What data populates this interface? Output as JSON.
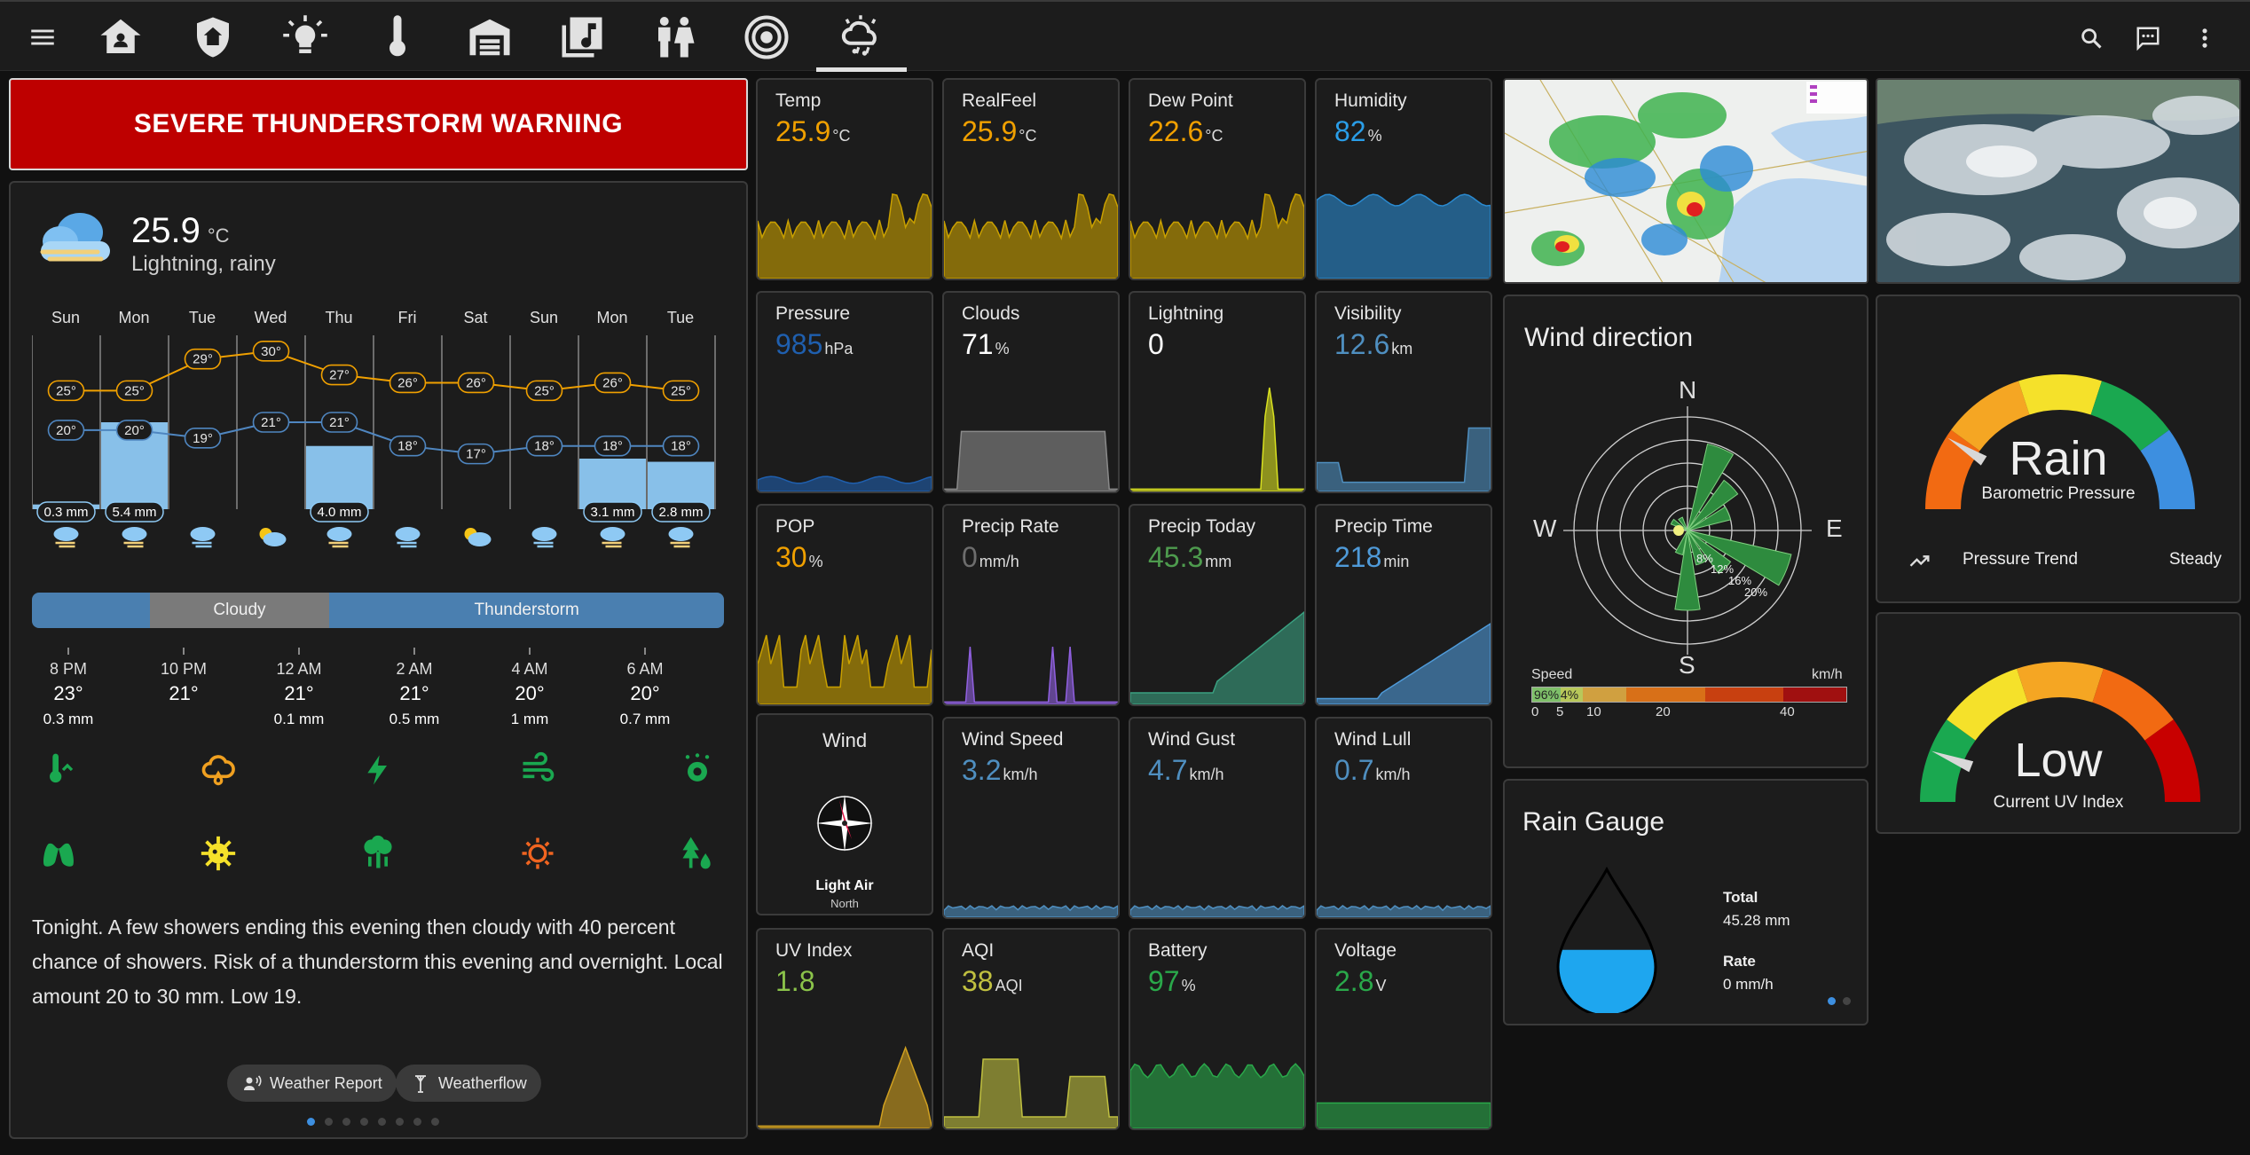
{
  "topbar": {
    "tabs": [
      {
        "name": "menu-icon"
      },
      {
        "name": "home-icon"
      },
      {
        "name": "security-shield-icon"
      },
      {
        "name": "lightbulb-icon"
      },
      {
        "name": "thermometer-icon"
      },
      {
        "name": "garage-icon"
      },
      {
        "name": "music-library-icon"
      },
      {
        "name": "people-icon"
      },
      {
        "name": "speaker-icon"
      },
      {
        "name": "weather-icon"
      }
    ],
    "actions": [
      "search-icon",
      "chat-icon",
      "more-vert-icon"
    ]
  },
  "warning": {
    "text": "SEVERE THUNDERSTORM WARNING",
    "color": "#be0000"
  },
  "forecast": {
    "temp": "25.9",
    "unit": "°C",
    "condition": "Lightning, rainy",
    "days": [
      "Sun",
      "Mon",
      "Tue",
      "Wed",
      "Thu",
      "Fri",
      "Sat",
      "Sun",
      "Mon",
      "Tue"
    ],
    "highs": [
      "25°",
      "25°",
      "29°",
      "30°",
      "27°",
      "26°",
      "26°",
      "25°",
      "26°",
      "25°"
    ],
    "lows": [
      "20°",
      "20°",
      "19°",
      "21°",
      "21°",
      "18°",
      "17°",
      "18°",
      "18°",
      "18°"
    ],
    "precip": [
      {
        "day": 0,
        "amount": "0.3 mm",
        "level": 0.03
      },
      {
        "day": 1,
        "amount": "5.4 mm",
        "level": 0.55
      },
      {
        "day": 4,
        "amount": "4.0 mm",
        "level": 0.4
      },
      {
        "day": 8,
        "amount": "3.1 mm",
        "level": 0.32
      },
      {
        "day": 9,
        "amount": "2.8 mm",
        "level": 0.3
      }
    ],
    "condbar": [
      {
        "label": "",
        "fraction": 0.17,
        "color": "#4a7fb0"
      },
      {
        "label": "Cloudy",
        "fraction": 0.26,
        "color": "#7a7a7a"
      },
      {
        "label": "Thunderstorm",
        "fraction": 0.57,
        "color": "#4a7fb0"
      }
    ],
    "hours": [
      {
        "time": "8 PM",
        "temp": "23°",
        "precip": "0.3 mm"
      },
      {
        "time": "10 PM",
        "temp": "21°",
        "precip": ""
      },
      {
        "time": "12 AM",
        "temp": "21°",
        "precip": "0.1 mm"
      },
      {
        "time": "2 AM",
        "temp": "21°",
        "precip": "0.5 mm"
      },
      {
        "time": "4 AM",
        "temp": "20°",
        "precip": "1 mm"
      },
      {
        "time": "6 AM",
        "temp": "20°",
        "precip": "0.7 mm"
      }
    ],
    "narrative": "Tonight. A few showers ending this evening then cloudy with 40 percent chance of showers. Risk of a thunderstorm this evening and overnight. Local amount 20 to 30 mm. Low 19.",
    "chips": [
      "Weather Report",
      "Weatherflow"
    ]
  },
  "sensors": [
    {
      "name": "Temp",
      "value": "25.9",
      "unit": "°C",
      "color": "#f0a000"
    },
    {
      "name": "RealFeel",
      "value": "25.9",
      "unit": "°C",
      "color": "#f0a000"
    },
    {
      "name": "Dew Point",
      "value": "22.6",
      "unit": "°C",
      "color": "#f0a000"
    },
    {
      "name": "Humidity",
      "value": "82",
      "unit": "%",
      "color": "#2a9ee8"
    },
    {
      "name": "Pressure",
      "value": "985",
      "unit": "hPa",
      "color": "#1f5fae"
    },
    {
      "name": "Clouds",
      "value": "71",
      "unit": "%",
      "color": "#ffffff"
    },
    {
      "name": "Lightning",
      "value": "0",
      "unit": "",
      "color": "#ffffff"
    },
    {
      "name": "Visibility",
      "value": "12.6",
      "unit": "km",
      "color": "#4f8fc0"
    },
    {
      "name": "POP",
      "value": "30",
      "unit": "%",
      "color": "#f0a000"
    },
    {
      "name": "Precip Rate",
      "value": "0",
      "unit": "mm/h",
      "color": "#6d6d6d"
    },
    {
      "name": "Precip Today",
      "value": "45.3",
      "unit": "mm",
      "color": "#4e9b4e"
    },
    {
      "name": "Precip Time",
      "value": "218",
      "unit": "min",
      "color": "#4f9ad8"
    },
    {
      "name": "Wind Speed",
      "value": "3.2",
      "unit": "km/h",
      "color": "#4f8fc0"
    },
    {
      "name": "Wind Gust",
      "value": "4.7",
      "unit": "km/h",
      "color": "#4f8fc0"
    },
    {
      "name": "Wind Lull",
      "value": "0.7",
      "unit": "km/h",
      "color": "#4f8fc0"
    },
    {
      "name": "UV Index",
      "value": "1.8",
      "unit": "",
      "color": "#8bc34a"
    },
    {
      "name": "AQI",
      "value": "38",
      "unit": "AQI",
      "color": "#c0c040"
    },
    {
      "name": "Battery",
      "value": "97",
      "unit": "%",
      "color": "#2aa84a"
    },
    {
      "name": "Voltage",
      "value": "2.8",
      "unit": "V",
      "color": "#2aa84a"
    }
  ],
  "wind_card": {
    "title": "Wind",
    "description": "Light Air",
    "direction": "North"
  },
  "wind_rose": {
    "title": "Wind direction",
    "cardinals": [
      "N",
      "E",
      "S",
      "W"
    ],
    "rings": [
      "8%",
      "12%",
      "16%",
      "20%"
    ],
    "speed_label": "Speed",
    "speed_unit": "km/h",
    "speed_ticks": [
      "0",
      "5",
      "10",
      "20",
      "40"
    ],
    "speed_pcts": [
      "96%",
      "4%"
    ]
  },
  "pressure_gauge": {
    "value": "Rain",
    "label": "Barometric Pressure",
    "trend_label": "Pressure Trend",
    "trend_value": "Steady",
    "needle": 0.18
  },
  "uv_gauge": {
    "value": "Low",
    "label": "Current UV Index",
    "needle": 0.12
  },
  "rain_gauge": {
    "title": "Rain Gauge",
    "total_label": "Total",
    "total": "45.28 mm",
    "rate_label": "Rate",
    "rate": "0 mm/h",
    "fill": 0.45
  }
}
